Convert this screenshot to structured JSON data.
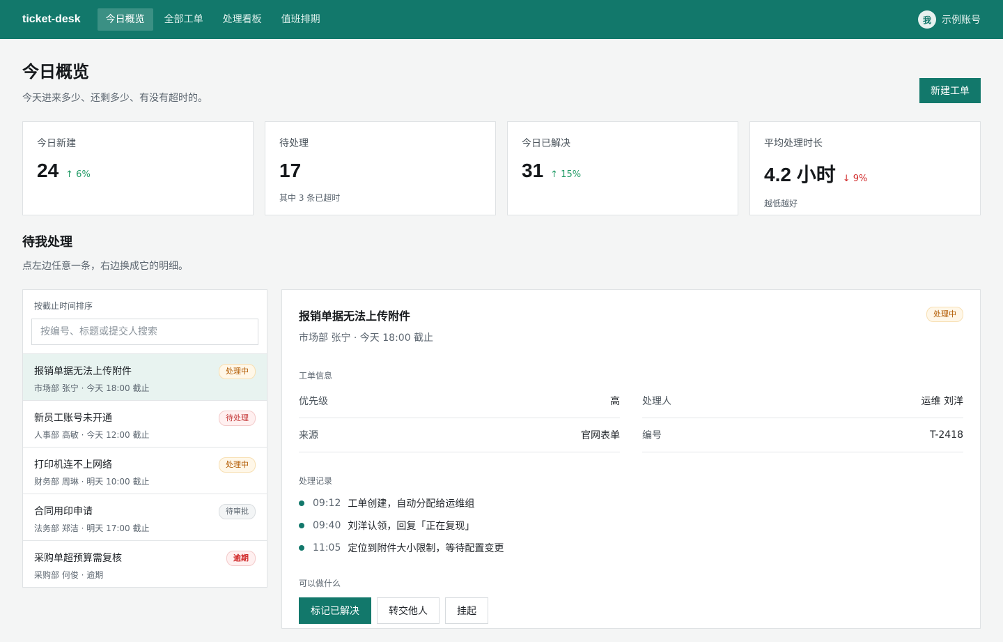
{
  "app": {
    "brand": "ticket-desk"
  },
  "nav": [
    {
      "label": "今日概览",
      "active": true
    },
    {
      "label": "全部工单",
      "active": false
    },
    {
      "label": "处理看板",
      "active": false
    },
    {
      "label": "值班排期",
      "active": false
    }
  ],
  "user": {
    "avatar": "我",
    "name": "示例账号"
  },
  "page": {
    "title": "今日概览",
    "subtitle": "今天进来多少、还剩多少、有没有超时的。",
    "new_button": "新建工单"
  },
  "stats": [
    {
      "label": "今日新建",
      "value": "24",
      "trend": "↑ 6%",
      "direction": "up",
      "note": ""
    },
    {
      "label": "待处理",
      "value": "17",
      "trend": "",
      "direction": "",
      "note": "其中 3 条已超时"
    },
    {
      "label": "今日已解决",
      "value": "31",
      "trend": "↑ 15%",
      "direction": "up",
      "note": ""
    },
    {
      "label": "平均处理时长",
      "value": "4.2 小时",
      "trend": "↓ 9%",
      "direction": "down",
      "note": "越低越好"
    }
  ],
  "section": {
    "title": "待我处理",
    "subtitle": "点左边任意一条，右边换成它的明细。"
  },
  "list": {
    "sort_label": "按截止时间排序",
    "search_placeholder": "按编号、标题或提交人搜索",
    "items": [
      {
        "title": "报销单据无法上传附件",
        "meta": "市场部 张宁 · 今天 18:00 截止",
        "status": "处理中",
        "status_kind": "processing",
        "selected": true
      },
      {
        "title": "新员工账号未开通",
        "meta": "人事部 高敏 · 今天 12:00 截止",
        "status": "待处理",
        "status_kind": "pending",
        "selected": false
      },
      {
        "title": "打印机连不上网络",
        "meta": "财务部 周琳 · 明天 10:00 截止",
        "status": "处理中",
        "status_kind": "processing",
        "selected": false
      },
      {
        "title": "合同用印申请",
        "meta": "法务部 郑洁 · 明天 17:00 截止",
        "status": "待审批",
        "status_kind": "review",
        "selected": false
      },
      {
        "title": "采购单超预算需复核",
        "meta": "采购部 何俊 · 逾期",
        "status": "逾期",
        "status_kind": "overdue",
        "selected": false
      }
    ]
  },
  "detail": {
    "title": "报销单据无法上传附件",
    "meta": "市场部 张宁 · 今天 18:00 截止",
    "status": "处理中",
    "info_head": "工单信息",
    "fields": [
      {
        "label": "优先级",
        "value": "高"
      },
      {
        "label": "处理人",
        "value": "运维 刘洋"
      },
      {
        "label": "来源",
        "value": "官网表单"
      },
      {
        "label": "编号",
        "value": "T-2418"
      }
    ],
    "log_head": "处理记录",
    "log": [
      {
        "time": "09:12",
        "text": "工单创建，自动分配给运维组"
      },
      {
        "time": "09:40",
        "text": "刘洋认领，回复「正在复现」"
      },
      {
        "time": "11:05",
        "text": "定位到附件大小限制，等待配置变更"
      }
    ],
    "actions_head": "可以做什么",
    "actions": [
      "标记已解决",
      "转交他人",
      "挂起"
    ]
  },
  "colors": {
    "brand": "#12786b",
    "up": "#1f9a64",
    "down": "#d12b2b"
  }
}
